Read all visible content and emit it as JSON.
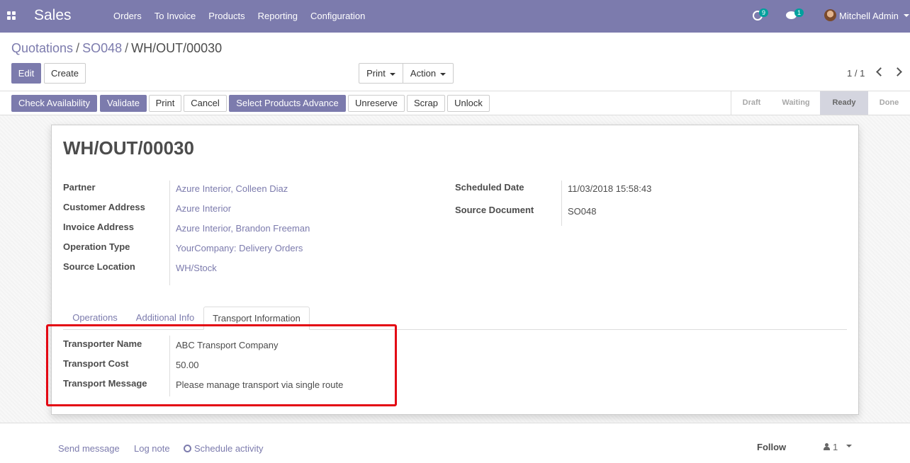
{
  "navbar": {
    "app_title": "Sales",
    "menu": [
      "Orders",
      "To Invoice",
      "Products",
      "Reporting",
      "Configuration"
    ],
    "activity_count": "9",
    "messages_count": "1",
    "user_name": "Mitchell Admin"
  },
  "breadcrumb": {
    "items": [
      "Quotations",
      "SO048"
    ],
    "current": "WH/OUT/00030"
  },
  "control": {
    "edit_label": "Edit",
    "create_label": "Create",
    "print_label": "Print",
    "action_label": "Action",
    "pager": "1 / 1"
  },
  "statusbar": {
    "buttons": [
      "Check Availability",
      "Validate",
      "Print",
      "Cancel",
      "Select Products Advance",
      "Unreserve",
      "Scrap",
      "Unlock"
    ],
    "stages": [
      "Draft",
      "Waiting",
      "Ready",
      "Done"
    ],
    "active_stage": "Ready"
  },
  "record": {
    "title": "WH/OUT/00030",
    "left_fields": [
      {
        "label": "Partner",
        "value": "Azure Interior, Colleen Diaz"
      },
      {
        "label": "Customer Address",
        "value": "Azure Interior"
      },
      {
        "label": "Invoice Address",
        "value": "Azure Interior, Brandon Freeman"
      },
      {
        "label": "Operation Type",
        "value": "YourCompany: Delivery Orders"
      },
      {
        "label": "Source Location",
        "value": "WH/Stock"
      }
    ],
    "right_fields": [
      {
        "label": "Scheduled Date",
        "value": "11/03/2018 15:58:43"
      },
      {
        "label": "Source Document",
        "value": "SO048"
      }
    ]
  },
  "tabs": [
    "Operations",
    "Additional Info",
    "Transport Information"
  ],
  "active_tab": "Transport Information",
  "transport": [
    {
      "label": "Transporter Name",
      "value": "ABC Transport Company"
    },
    {
      "label": "Transport Cost",
      "value": "50.00"
    },
    {
      "label": "Transport Message",
      "value": "Please manage transport via single route"
    }
  ],
  "chatter": {
    "send_message": "Send message",
    "log_note": "Log note",
    "schedule_activity": "Schedule activity",
    "follow": "Follow",
    "followers_count": "1"
  },
  "colors": {
    "brand": "#7c7bad",
    "highlight": "#e30613",
    "badge": "#00a09d"
  }
}
